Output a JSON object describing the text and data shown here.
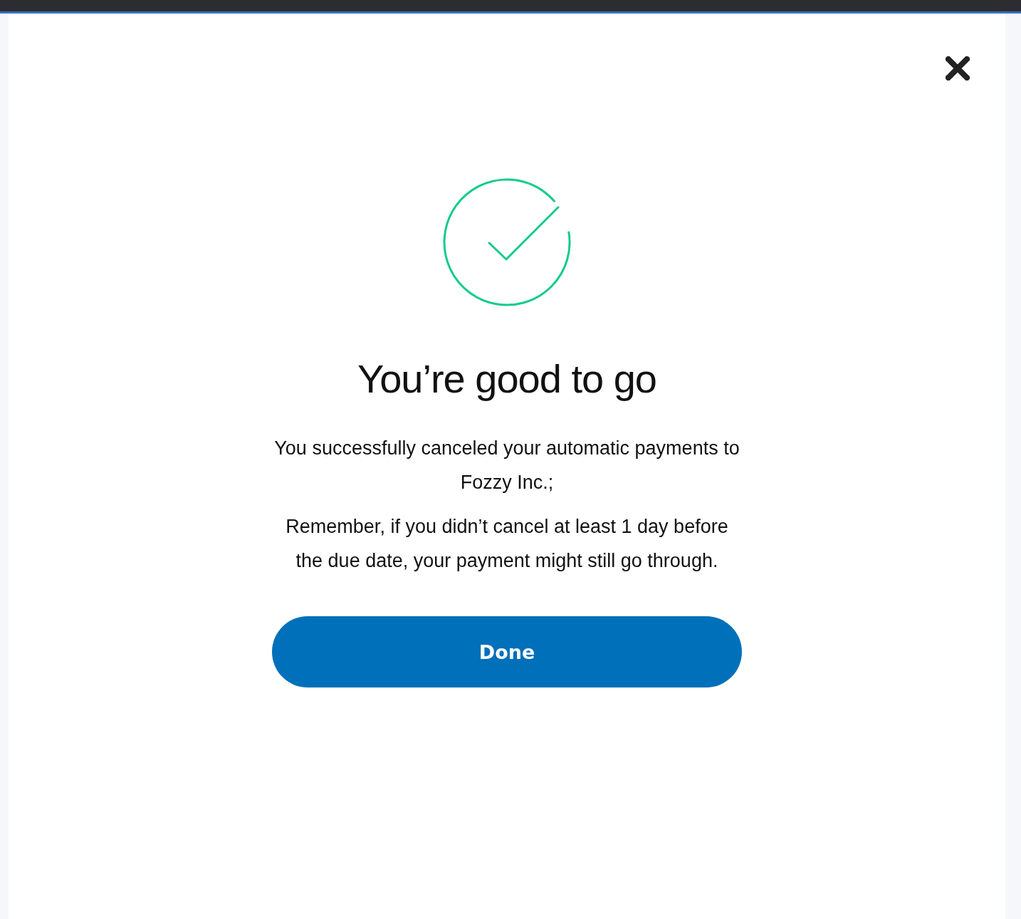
{
  "dialog": {
    "title": "You’re good to go",
    "messages": [
      "You successfully canceled your automatic payments to Fozzy Inc.;",
      "Remember, if you didn’t cancel at least 1 day before the due date, your payment might still go through."
    ],
    "button": "Done"
  }
}
